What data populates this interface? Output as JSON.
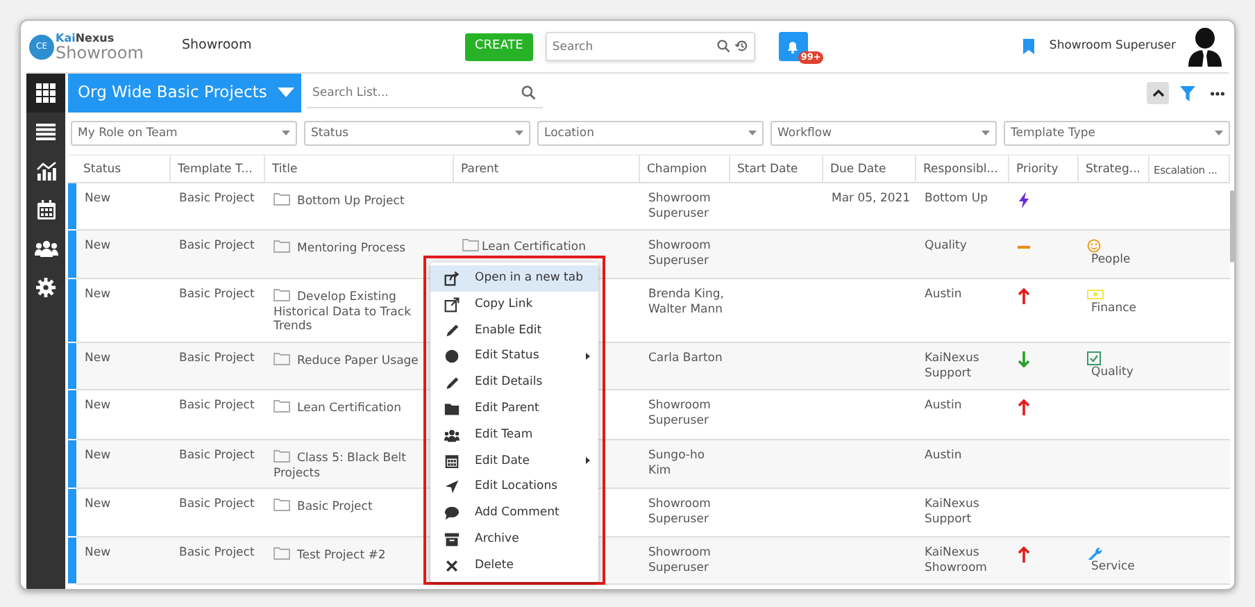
{
  "header": {
    "logo": {
      "brand_prefix": "Kai",
      "brand_suffix": "Nexus",
      "subtitle": "Showroom",
      "badge": "CE"
    },
    "workspace": "Showroom",
    "create_button": "CREATE",
    "search": {
      "placeholder": "Search"
    },
    "notifications": {
      "badge": "99+"
    },
    "user": "Showroom Superuser"
  },
  "list": {
    "title": "Org Wide Basic Projects",
    "search": {
      "placeholder": "Search List..."
    }
  },
  "filters": [
    {
      "placeholder": "My Role on Team"
    },
    {
      "placeholder": "Status"
    },
    {
      "placeholder": "Location"
    },
    {
      "placeholder": "Workflow"
    },
    {
      "placeholder": "Template Type"
    }
  ],
  "table": {
    "columns": [
      "Status",
      "Template T...",
      "Title",
      "Parent",
      "Champion",
      "Start Date",
      "Due Date",
      "Responsibl...",
      "Priority",
      "Strateg...",
      "Escalation ..."
    ],
    "rows": [
      {
        "status": "New",
        "template": "Basic Project",
        "title": "Bottom Up Project",
        "champion": "Showroom Superuser",
        "due_date": "Mar 05, 2021",
        "responsible": "Bottom Up",
        "priority": {
          "kind": "urgent"
        }
      },
      {
        "status": "New",
        "template": "Basic Project",
        "title": "Mentoring Process",
        "parent": "Lean Certification",
        "champion": "Showroom Superuser",
        "responsible": "Quality",
        "priority": {
          "kind": "medium"
        },
        "strategy": {
          "kind": "people",
          "label": "People"
        }
      },
      {
        "status": "New",
        "template": "Basic Project",
        "title": "Develop Existing Historical Data to Track Trends",
        "champion": "Brenda King, Walter Mann",
        "responsible": "Austin",
        "priority": {
          "kind": "high"
        },
        "strategy": {
          "kind": "finance",
          "label": "Finance"
        }
      },
      {
        "status": "New",
        "template": "Basic Project",
        "title": "Reduce Paper Usage",
        "champion": "Carla Barton",
        "responsible": "KaiNexus Support",
        "priority": {
          "kind": "low"
        },
        "strategy": {
          "kind": "quality",
          "label": "Quality"
        }
      },
      {
        "status": "New",
        "template": "Basic Project",
        "title": "Lean Certification",
        "champion": "Showroom Superuser",
        "responsible": "Austin",
        "priority": {
          "kind": "high"
        }
      },
      {
        "status": "New",
        "template": "Basic Project",
        "title": "Class 5: Black Belt Projects",
        "champion": "Sungo-ho Kim",
        "responsible": "Austin"
      },
      {
        "status": "New",
        "template": "Basic Project",
        "title": "Basic Project",
        "champion": "Showroom Superuser",
        "responsible": "KaiNexus Support"
      },
      {
        "status": "New",
        "template": "Basic Project",
        "title": "Test Project #2",
        "champion": "Showroom Superuser",
        "responsible": "KaiNexus Showroom",
        "priority": {
          "kind": "high"
        },
        "strategy": {
          "kind": "service",
          "label": "Service"
        }
      }
    ]
  },
  "context_menu": {
    "items": [
      {
        "kind": "open-tab",
        "label": "Open in a new tab",
        "selected": true,
        "submenu": false
      },
      {
        "kind": "link",
        "label": "Copy Link",
        "selected": false,
        "submenu": false
      },
      {
        "kind": "pencil",
        "label": "Enable Edit",
        "selected": false,
        "submenu": false
      },
      {
        "kind": "circle",
        "label": "Edit Status",
        "selected": false,
        "submenu": true
      },
      {
        "kind": "pencil",
        "label": "Edit Details",
        "selected": false,
        "submenu": false
      },
      {
        "kind": "folder",
        "label": "Edit Parent",
        "selected": false,
        "submenu": false
      },
      {
        "kind": "team",
        "label": "Edit Team",
        "selected": false,
        "submenu": false
      },
      {
        "kind": "calendar",
        "label": "Edit Date",
        "selected": false,
        "submenu": true
      },
      {
        "kind": "location",
        "label": "Edit Locations",
        "selected": false,
        "submenu": false
      },
      {
        "kind": "comment",
        "label": "Add Comment",
        "selected": false,
        "submenu": false
      },
      {
        "kind": "archive",
        "label": "Archive",
        "selected": false,
        "submenu": false
      },
      {
        "kind": "close",
        "label": "Delete",
        "selected": false,
        "submenu": false
      }
    ]
  }
}
